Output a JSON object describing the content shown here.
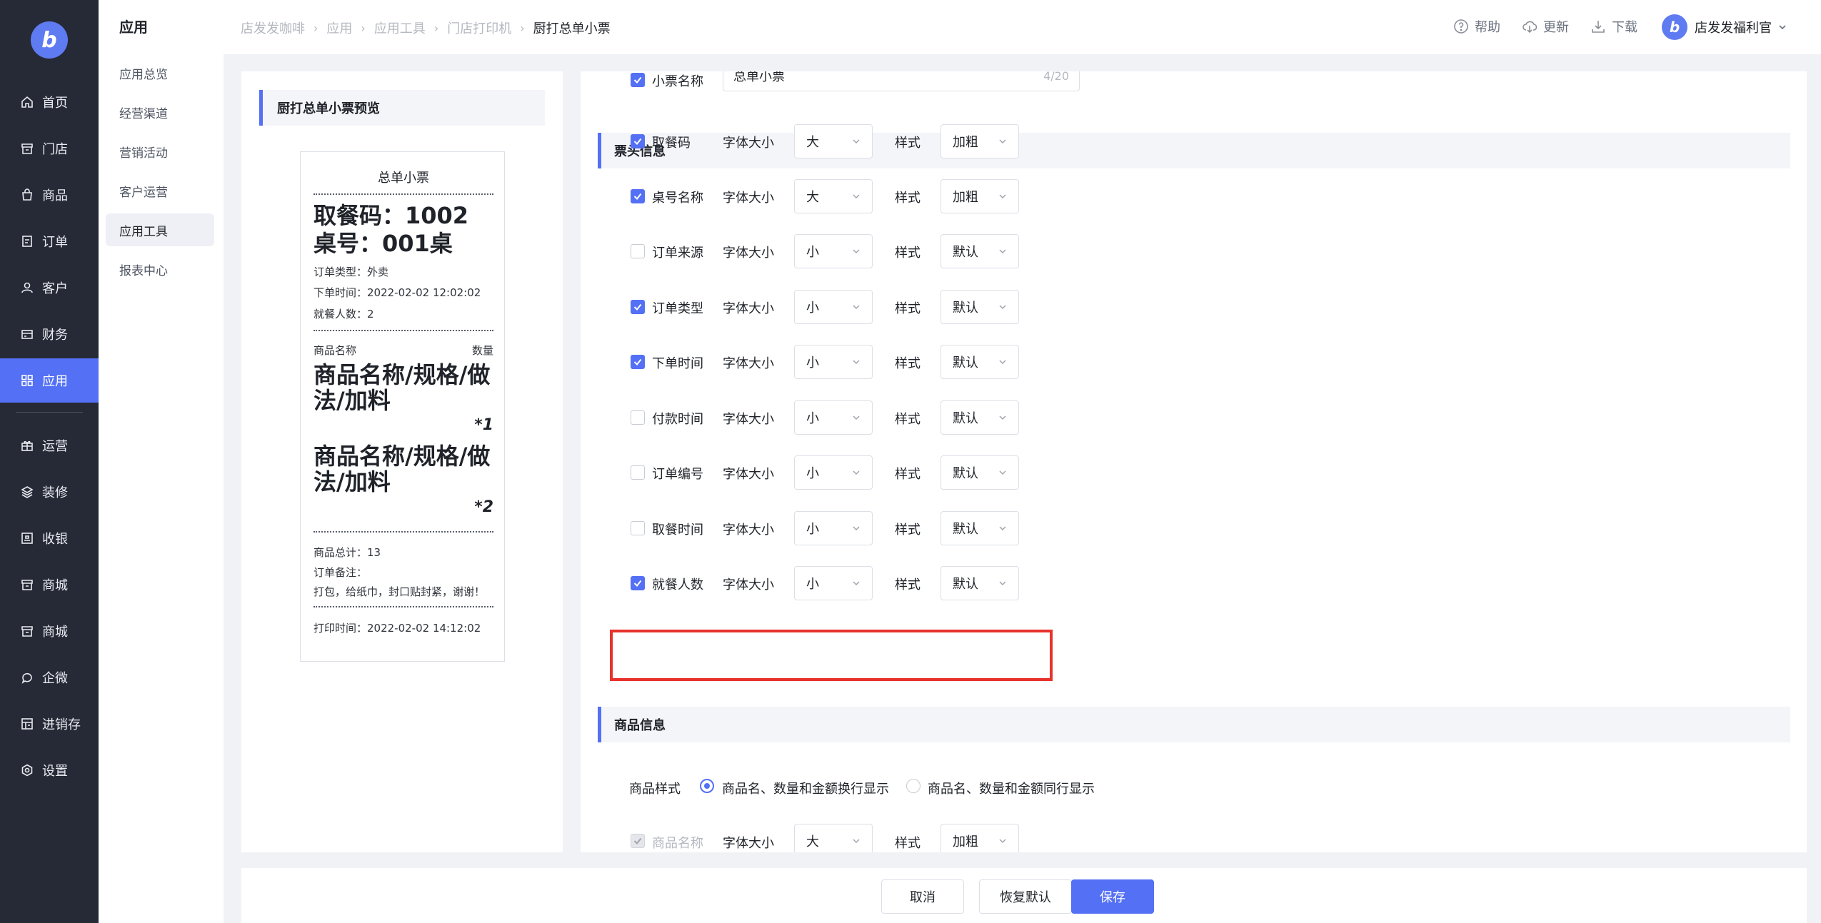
{
  "brand": {
    "logo_glyph": "b",
    "accent": "#5470f5",
    "sidebar_bg": "#262a37",
    "highlight": "#e8322c"
  },
  "sidebar": {
    "items": [
      {
        "label": "首页",
        "icon": "home-icon"
      },
      {
        "label": "门店",
        "icon": "store-icon"
      },
      {
        "label": "商品",
        "icon": "bag-icon"
      },
      {
        "label": "订单",
        "icon": "order-icon"
      },
      {
        "label": "客户",
        "icon": "user-icon"
      },
      {
        "label": "财务",
        "icon": "card-icon"
      },
      {
        "label": "应用",
        "icon": "apps-icon"
      },
      {
        "label": "运营",
        "icon": "gift-icon"
      },
      {
        "label": "装修",
        "icon": "layers-icon"
      },
      {
        "label": "收银",
        "icon": "cashier-icon"
      },
      {
        "label": "商城",
        "icon": "shop-icon"
      },
      {
        "label": "商城",
        "icon": "shop-icon"
      },
      {
        "label": "企微",
        "icon": "chat-icon"
      },
      {
        "label": "进销存",
        "icon": "inventory-icon"
      },
      {
        "label": "设置",
        "icon": "settings-icon"
      }
    ],
    "active": "应用"
  },
  "submenu": {
    "title": "应用",
    "items": [
      "应用总览",
      "经营渠道",
      "营销活动",
      "客户运营",
      "应用工具",
      "报表中心"
    ],
    "active": "应用工具"
  },
  "header": {
    "breadcrumb": [
      "店发发咖啡",
      "应用",
      "应用工具",
      "门店打印机",
      "厨打总单小票"
    ],
    "help": "帮助",
    "update": "更新",
    "download": "下载",
    "user": "店发发福利官"
  },
  "preview": {
    "title": "厨打总单小票预览",
    "ticket": {
      "title": "总单小票",
      "pickup": "取餐码：1002",
      "table": "桌号：001桌",
      "order_type": "订单类型：外卖",
      "order_time": "下单时间：2022-02-02 12:02:02",
      "diners": "就餐人数：2",
      "col_name": "商品名称",
      "col_qty": "数量",
      "item1_line1": "商品名称/规格/做",
      "item1_line2": "法/加料",
      "item1_qty": "*1",
      "item2_line1": "商品名称/规格/做",
      "item2_line2": "法/加料",
      "item2_qty": "*2",
      "total": "商品总计：13",
      "remark_label": "订单备注：",
      "remark": "打包，给纸巾，封口贴封紧，谢谢！",
      "print_time": "打印时间：2022-02-02 14:12:02"
    }
  },
  "settings": {
    "ticket_name": {
      "label": "小票名称",
      "value": "总单小票",
      "counter": "4/20",
      "checked": true
    },
    "header_section": "票头信息",
    "font_size_label": "字体大小",
    "style_label": "样式",
    "fields": [
      {
        "label": "取餐码",
        "checked": true,
        "size": "大",
        "style": "加粗"
      },
      {
        "label": "桌号名称",
        "checked": true,
        "size": "大",
        "style": "加粗"
      },
      {
        "label": "订单来源",
        "checked": false,
        "size": "小",
        "style": "默认"
      },
      {
        "label": "订单类型",
        "checked": true,
        "size": "小",
        "style": "默认"
      },
      {
        "label": "下单时间",
        "checked": true,
        "size": "小",
        "style": "默认"
      },
      {
        "label": "付款时间",
        "checked": false,
        "size": "小",
        "style": "默认"
      },
      {
        "label": "订单编号",
        "checked": false,
        "size": "小",
        "style": "默认"
      },
      {
        "label": "取餐时间",
        "checked": false,
        "size": "小",
        "style": "默认"
      },
      {
        "label": "就餐人数",
        "checked": true,
        "size": "小",
        "style": "默认"
      }
    ],
    "goods_section": "商品信息",
    "goods_style_label": "商品样式",
    "goods_style_options": [
      "商品名、数量和金额换行显示",
      "商品名、数量和金额同行显示"
    ],
    "goods_style_selected": 0,
    "goods_name": {
      "label": "商品名称",
      "size": "大",
      "style": "加粗",
      "disabled": true
    }
  },
  "footer": {
    "cancel": "取消",
    "reset": "恢复默认",
    "save": "保存"
  }
}
